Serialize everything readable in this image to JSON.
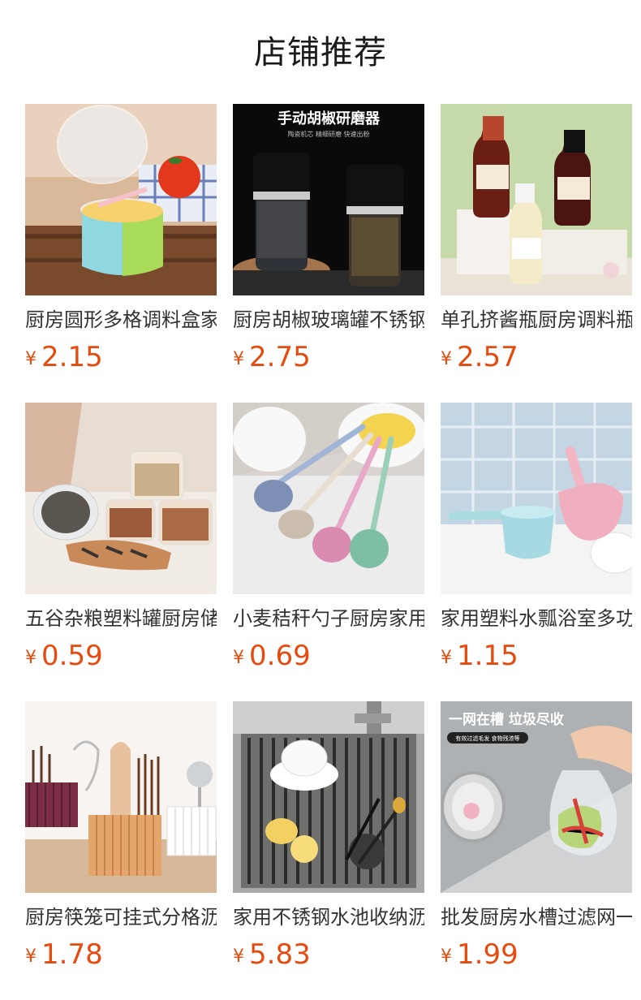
{
  "header": {
    "title": "店铺推荐"
  },
  "products": [
    {
      "name": "厨房圆形多格调料盒家用",
      "currency": "¥",
      "price": "2.15",
      "image": "seasoning-box"
    },
    {
      "name": "厨房胡椒玻璃罐不锈钢研磨器",
      "currency": "¥",
      "price": "2.75",
      "image": "pepper-grinder",
      "image_text": {
        "title": "手动胡椒研磨器",
        "subtitle": "陶瓷机芯 精细研磨 快速出粉"
      }
    },
    {
      "name": "单孔挤酱瓶厨房调料瓶",
      "currency": "¥",
      "price": "2.57",
      "image": "squeeze-bottles"
    },
    {
      "name": "五谷杂粮塑料罐厨房储物罐",
      "currency": "¥",
      "price": "0.59",
      "image": "grain-jars"
    },
    {
      "name": "小麦秸秆勺子厨房家用漏勺",
      "currency": "¥",
      "price": "0.69",
      "image": "ladles"
    },
    {
      "name": "家用塑料水瓢浴室多功能",
      "currency": "¥",
      "price": "1.15",
      "image": "water-scoops"
    },
    {
      "name": "厨房筷笼可挂式分格沥水",
      "currency": "¥",
      "price": "1.78",
      "image": "chopstick-holders"
    },
    {
      "name": "家用不锈钢水池收纳沥水架",
      "currency": "¥",
      "price": "5.83",
      "image": "sink-rack"
    },
    {
      "name": "批发厨房水槽过滤网一次性",
      "currency": "¥",
      "price": "1.99",
      "image": "sink-filter",
      "image_text": {
        "title": "一网在槽 垃圾尽收",
        "subtitle": "有效过滤毛发 食物残渣等"
      }
    }
  ],
  "colors": {
    "price": "#e64a0f",
    "title": "#1a1a1a",
    "name": "#333333"
  }
}
